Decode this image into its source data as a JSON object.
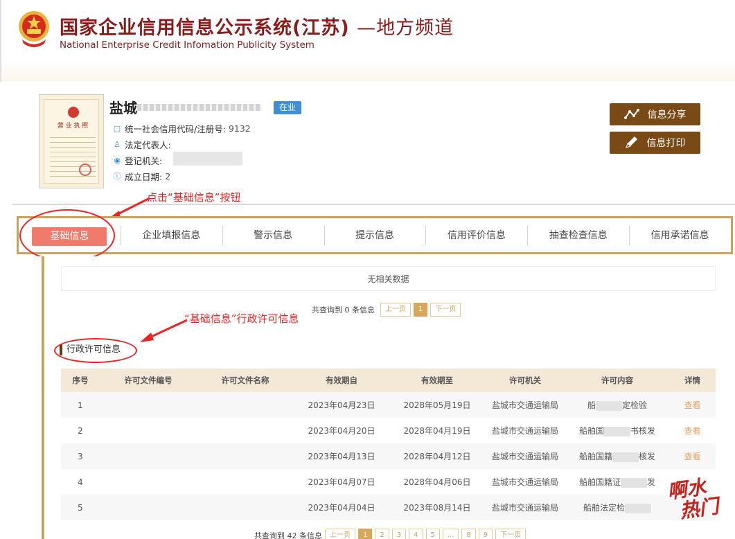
{
  "header": {
    "title": "国家企业信用信息公示系统(江苏)",
    "title_suffix": "—地方频道",
    "subtitle": "National Enterprise Credit Infomation Publicity System"
  },
  "company": {
    "license_label": "营 业 执 照",
    "name": "盐城",
    "status": "在业",
    "credit_code_label": "统一社会信用代码/注册号:",
    "credit_code_value": "9132",
    "legal_rep_label": "法定代表人:",
    "authority_label": "登记机关:",
    "founded_label": "成立日期:",
    "founded_value": "2"
  },
  "actions": {
    "share_label": "信息分享",
    "print_label": "信息打印"
  },
  "annotations": {
    "click_hint": "点击“基础信息”按钮",
    "section_hint": "“基础信息”行政许可信息"
  },
  "tabs": [
    {
      "label": "基础信息"
    },
    {
      "label": "企业填报信息"
    },
    {
      "label": "警示信息"
    },
    {
      "label": "提示信息"
    },
    {
      "label": "信用评价信息"
    },
    {
      "label": "抽查检查信息"
    },
    {
      "label": "信用承诺信息"
    }
  ],
  "previous_section": {
    "no_data_text": "无相关数据",
    "pager": {
      "total_text": "共查询到 0 条信息",
      "prev": "上一页",
      "current": "1",
      "next": "下一页"
    }
  },
  "permit_section": {
    "title": "行政许可信息",
    "columns": [
      "序号",
      "许可文件编号",
      "许可文件名称",
      "有效期自",
      "有效期至",
      "许可机关",
      "许可内容",
      "详情"
    ],
    "rows": [
      {
        "no": "1",
        "doc_no": "",
        "doc_name": "",
        "from": "2023年04月23日",
        "to": "2028年05月19日",
        "authority": "盐城市交通运输局",
        "content_a": "船",
        "content_b": "定检验",
        "detail": "查看"
      },
      {
        "no": "2",
        "doc_no": "",
        "doc_name": "",
        "from": "2023年04月20日",
        "to": "2028年04月19日",
        "authority": "盐城市交通运输局",
        "content_a": "船舶国",
        "content_b": "书核发",
        "detail": "查看"
      },
      {
        "no": "3",
        "doc_no": "",
        "doc_name": "",
        "from": "2023年04月13日",
        "to": "2028年04月12日",
        "authority": "盐城市交通运输局",
        "content_a": "船舶国籍",
        "content_b": "核发",
        "detail": "查看"
      },
      {
        "no": "4",
        "doc_no": "",
        "doc_name": "",
        "from": "2023年04月07日",
        "to": "2028年04月06日",
        "authority": "盐城市交通运输局",
        "content_a": "船舶国籍证",
        "content_b": "发",
        "detail": ""
      },
      {
        "no": "5",
        "doc_no": "",
        "doc_name": "",
        "from": "2023年04月04日",
        "to": "2023年08月14日",
        "authority": "盐城市交通运输局",
        "content_a": "船舶法定检",
        "content_b": "",
        "detail": ""
      }
    ],
    "pager": {
      "total_text": "共查询到 42 条信息",
      "prev": "上一页",
      "pages": [
        "1",
        "2",
        "3",
        "4",
        "5",
        "...",
        "8",
        "9"
      ],
      "next": "下一页"
    }
  },
  "watermark": {
    "line1": "啊水",
    "line2": "热门"
  }
}
